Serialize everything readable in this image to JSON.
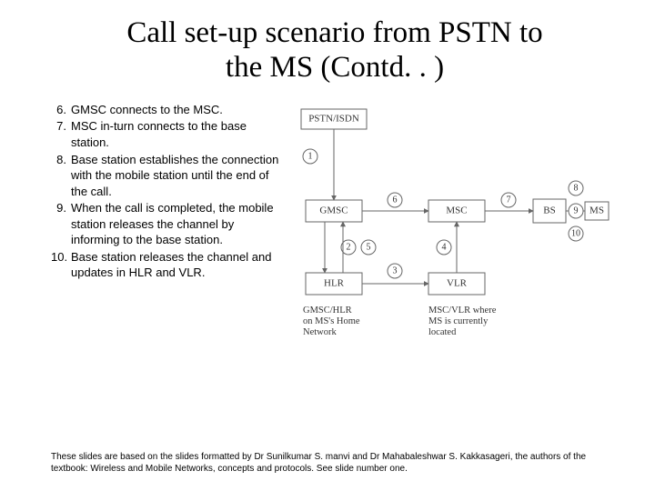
{
  "title_line1": "Call set-up scenario from PSTN to",
  "title_line2": "the MS (Contd. . )",
  "steps": [
    {
      "n": "6.",
      "t": "GMSC connects to the MSC."
    },
    {
      "n": "7.",
      "t": "MSC in-turn connects to the base station."
    },
    {
      "n": "8.",
      "t": "Base station establishes the connection with the mobile station until the end of the call."
    },
    {
      "n": "9.",
      "t": "When the call is completed, the mobile station releases the channel by informing to the base station."
    },
    {
      "n": "10.",
      "t": "Base station releases the channel and updates in HLR and VLR."
    }
  ],
  "diagram": {
    "boxes": {
      "pstn": "PSTN/ISDN",
      "gmsc": "GMSC",
      "hlr": "HLR",
      "msc": "MSC",
      "vlr": "VLR",
      "bs": "BS",
      "ms": "MS"
    },
    "edge_labels": {
      "e1": "1",
      "e2": "2",
      "e3": "3",
      "e4": "4",
      "e5": "5",
      "e6": "6",
      "e7": "7",
      "e8": "8",
      "e9": "9",
      "e10": "10"
    },
    "captions": {
      "left1": "GMSC/HLR",
      "left2": "on MS's Home",
      "left3": "Network",
      "right1": "MSC/VLR where",
      "right2": "MS is currently",
      "right3": "located"
    }
  },
  "footer": "These slides are based on the slides formatted by Dr Sunilkumar S. manvi and Dr Mahabaleshwar S. Kakkasageri, the authors of the textbook: Wireless and Mobile Networks, concepts and protocols. See slide number one."
}
